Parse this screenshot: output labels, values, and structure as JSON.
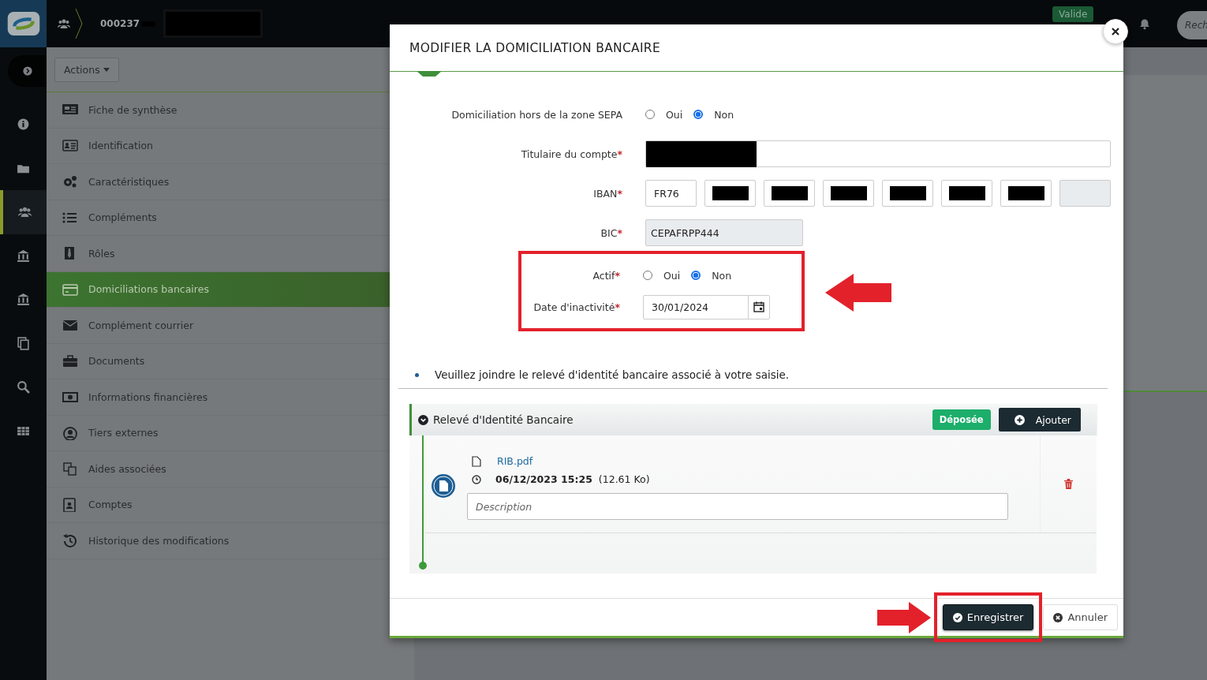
{
  "header": {
    "record_number": "000237",
    "valid_badge": "Valide",
    "search": {
      "placeholder": "Rech"
    }
  },
  "rail": {
    "items": [
      {
        "selected": false
      },
      {
        "selected": false
      },
      {
        "selected": true
      },
      {
        "selected": false
      },
      {
        "selected": false
      },
      {
        "selected": false
      },
      {
        "selected": false
      },
      {
        "selected": false
      }
    ]
  },
  "actions_button": "Actions",
  "menu": [
    {
      "label": "Fiche de synthèse",
      "selected": false
    },
    {
      "label": "Identification",
      "selected": false
    },
    {
      "label": "Caractéristiques",
      "selected": false
    },
    {
      "label": "Compléments",
      "selected": false
    },
    {
      "label": "Rôles",
      "selected": false
    },
    {
      "label": "Domiciliations bancaires",
      "selected": true
    },
    {
      "label": "Complément courrier",
      "selected": false
    },
    {
      "label": "Documents",
      "selected": false
    },
    {
      "label": "Informations financières",
      "selected": false
    },
    {
      "label": "Tiers externes",
      "selected": false
    },
    {
      "label": "Aides associées",
      "selected": false
    },
    {
      "label": "Comptes",
      "selected": false
    },
    {
      "label": "Historique des modifications",
      "selected": false
    }
  ],
  "modal": {
    "title": "MODIFIER LA DOMICILIATION BANCAIRE",
    "required_mark": "*",
    "fields": [
      {
        "kind": "radio",
        "label": "Domiciliation hors de la zone SEPA",
        "required": false,
        "options": [
          {
            "label": "Oui",
            "selected": false
          },
          {
            "label": "Non",
            "selected": true
          }
        ]
      },
      {
        "kind": "redacted",
        "label": "Titulaire du compte",
        "required": true
      },
      {
        "kind": "iban",
        "label": "IBAN",
        "required": true,
        "segments": [
          {
            "kind": "value",
            "value": "FR76"
          },
          {
            "kind": "redacted"
          },
          {
            "kind": "redacted"
          },
          {
            "kind": "redacted"
          },
          {
            "kind": "redacted"
          },
          {
            "kind": "redacted"
          },
          {
            "kind": "redacted"
          },
          {
            "kind": "empty"
          }
        ]
      },
      {
        "kind": "text",
        "label": "BIC",
        "required": true,
        "value": "CEPAFRPP444",
        "disabled": true
      }
    ],
    "highlighted_fields": [
      {
        "kind": "radio",
        "label": "Actif",
        "required": true,
        "options": [
          {
            "label": "Oui",
            "selected": false
          },
          {
            "label": "Non",
            "selected": true
          }
        ]
      },
      {
        "kind": "date",
        "label": "Date d'inactivité",
        "required": true,
        "value": "30/01/2024"
      }
    ],
    "notice": "Veuillez joindre le relevé d'identité bancaire associé à votre saisie.",
    "documents": {
      "title": "Relevé d'Identité Bancaire",
      "expanded": true,
      "status_badge": "Déposée",
      "add_button": "Ajouter",
      "files": [
        {
          "name": "RIB.pdf",
          "date": "06/12/2023 15:25",
          "size": "(12.61 Ko)",
          "description_placeholder": "Description"
        }
      ]
    },
    "buttons": [
      {
        "label": "Enregistrer",
        "kind": "primary",
        "highlighted": true
      },
      {
        "label": "Annuler",
        "kind": "default",
        "highlighted": false
      }
    ]
  }
}
